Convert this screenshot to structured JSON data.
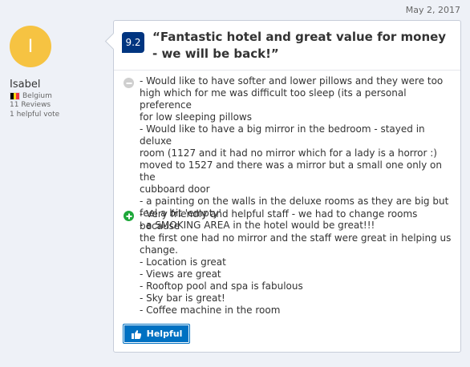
{
  "review": {
    "date": "May 2, 2017",
    "reviewer": {
      "initial": "I",
      "name": "Isabel",
      "country": "Belgium",
      "reviews": "11 Reviews",
      "helpful_votes": "1 helpful vote"
    },
    "score": "9.2",
    "title": "“Fantastic hotel and great value for money - we will be back!”",
    "negative": {
      "icon": "minus-circle-icon",
      "lines": [
        "- Would like to have softer and lower pillows and they were too",
        "high which for me was difficult too sleep (its a personal preference",
        "for low sleeping pillows",
        "- Would like to have a big mirror in the bedroom - stayed in deluxe",
        "room (1127 and it had no mirror which for a lady is a horror :)",
        "moved to 1527 and there was a mirror but a small one only on the",
        "cubboard door",
        "- a painting on the walls in the deluxe rooms as they are big but",
        "feel a bit 'empty'",
        "- a SMOKING AREA in the hotel would be great!!!"
      ]
    },
    "positive": {
      "icon": "plus-circle-icon",
      "lines": [
        "- Very friendly and helpful staff - we had to change rooms because",
        "the first one had no mirror and the staff were great in helping us",
        "change.",
        "- Location is great",
        "- Views are great",
        "- Rooftop pool and spa is fabulous",
        "- Sky bar is great!",
        "- Coffee machine in the room"
      ]
    },
    "helpful_button": "Helpful"
  },
  "colors": {
    "background": "#eef1f7",
    "score_bg": "#003580",
    "avatar": "#f6c342",
    "positive_icon": "#1ea83a",
    "negative_icon": "#cfcfcf",
    "button": "#0071c2"
  }
}
